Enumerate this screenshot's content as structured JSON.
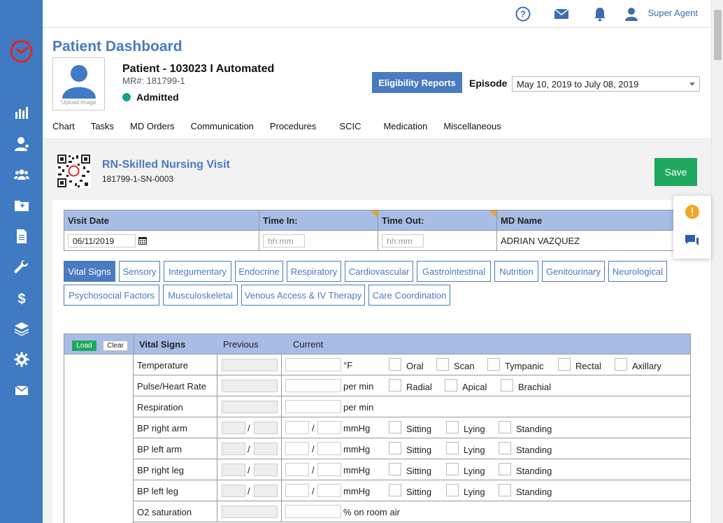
{
  "user": {
    "name": "Super Agent"
  },
  "sidebar": {
    "items": [
      {
        "icon": "bar-chart-icon"
      },
      {
        "icon": "user-doctor-icon"
      },
      {
        "icon": "users-icon"
      },
      {
        "icon": "folder-plus-icon"
      },
      {
        "icon": "document-icon"
      },
      {
        "icon": "wrench-icon"
      },
      {
        "icon": "dollar-icon"
      },
      {
        "icon": "layers-icon"
      },
      {
        "icon": "gear-icon"
      },
      {
        "icon": "envelope-icon"
      }
    ]
  },
  "header": {
    "title": "Patient Dashboard",
    "upload_label": "Upload Image",
    "patient_name": "Patient - 103023 I Automated",
    "mr": "MR#: 181799-1",
    "status": "Admitted",
    "eligibility_button": "Eligibility Reports",
    "episode_label": "Episode",
    "episode_value": "May 10, 2019 to July 08, 2019"
  },
  "tabs": [
    "Chart",
    "Tasks",
    "MD Orders",
    "Communication",
    "Procedures",
    "SCIC",
    "Medication",
    "Miscellaneous"
  ],
  "form": {
    "title": "RN-Skilled Nursing Visit",
    "code": "181799-1-SN-0003",
    "save_label": "Save"
  },
  "visit": {
    "headers": [
      "Visit Date",
      "Time In:",
      "Time Out:",
      "MD Name"
    ],
    "visit_date": "06/11/2019",
    "time_in_placeholder": "hh:mm",
    "time_out_placeholder": "hh:mm",
    "md_name": "ADRIAN VAZQUEZ"
  },
  "section_tabs": [
    "Vital Signs",
    "Sensory",
    "Integumentary",
    "Endocrine",
    "Respiratory",
    "Cardiovascular",
    "Gastrointestinal",
    "Nutrition",
    "Genitourinary",
    "Neurological",
    "Psychosocial Factors",
    "Musculoskeletal",
    "Venous Access & IV Therapy",
    "Care Coordination"
  ],
  "vitals": {
    "load_label": "Load",
    "clear_label": "Clear",
    "title": "Vital Signs",
    "previous_label": "Previous",
    "current_label": "Current",
    "rows": [
      {
        "label": "Temperature",
        "unit": "°F",
        "options": [
          "Oral",
          "Scan",
          "Tympanic",
          "Rectal",
          "Axillary"
        ]
      },
      {
        "label": "Pulse/Heart Rate",
        "unit": "per min",
        "options": [
          "Radial",
          "Apical",
          "Brachial"
        ]
      },
      {
        "label": "Respiration",
        "unit": "per min",
        "options": []
      },
      {
        "label": "BP right arm",
        "unit": "mmHg",
        "options": [
          "Sitting",
          "Lying",
          "Standing"
        ]
      },
      {
        "label": "BP left arm",
        "unit": "mmHg",
        "options": [
          "Sitting",
          "Lying",
          "Standing"
        ]
      },
      {
        "label": "BP right leg",
        "unit": "mmHg",
        "options": [
          "Sitting",
          "Lying",
          "Standing"
        ]
      },
      {
        "label": "BP left leg",
        "unit": "mmHg",
        "options": [
          "Sitting",
          "Lying",
          "Standing"
        ]
      },
      {
        "label": "O2 saturation",
        "unit": "% on room air",
        "options": []
      }
    ],
    "slash": "/"
  },
  "colors": {
    "primary": "#4a7ac0",
    "sidebar": "#3f7ac2",
    "save": "#1fa85f",
    "header_row": "#a7bde5"
  }
}
